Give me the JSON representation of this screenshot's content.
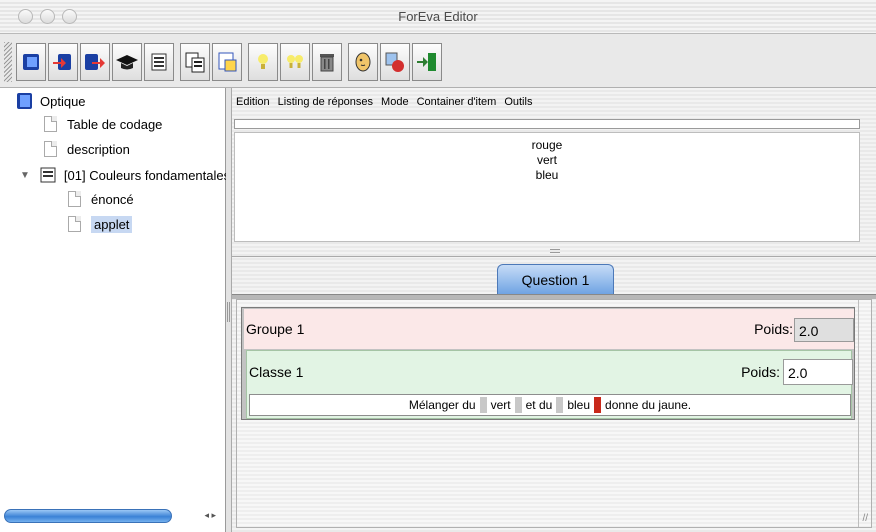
{
  "window": {
    "title": "ForEva Editor"
  },
  "toolbar": {
    "buttons": [
      {
        "icon": "open-book-icon",
        "color": "#1a3fa3"
      },
      {
        "icon": "book-import-icon",
        "color": "#d33"
      },
      {
        "icon": "book-export-icon",
        "color": "#d33"
      },
      {
        "icon": "graduation-cap-icon",
        "color": "#111"
      },
      {
        "icon": "list-icon",
        "color": "#333"
      },
      {
        "icon": "copy-documents-icon",
        "color": "#222"
      },
      {
        "icon": "paste-document-icon",
        "color": "#3355bb"
      },
      {
        "icon": "lightbulb-icon",
        "color": "#f2e34a"
      },
      {
        "icon": "double-lightbulb-icon",
        "color": "#f2e34a"
      },
      {
        "icon": "trash-icon",
        "color": "#666"
      },
      {
        "icon": "face-icon",
        "color": "#e6b84c"
      },
      {
        "icon": "stop-document-icon",
        "color": "#c62828"
      },
      {
        "icon": "exit-door-icon",
        "color": "#1f8a2f"
      }
    ]
  },
  "tree": {
    "root": "Optique",
    "items": [
      {
        "label": "Table de codage"
      },
      {
        "label": "description"
      },
      {
        "label": "[01] Couleurs fondamentales"
      },
      {
        "label": "énoncé"
      },
      {
        "label": "applet"
      }
    ]
  },
  "menu": [
    "Edition",
    "Listing de réponses",
    "Mode",
    "Container d'item",
    "Outils"
  ],
  "answers": [
    "rouge",
    "vert",
    "bleu"
  ],
  "tab": {
    "label": "Question 1"
  },
  "group": {
    "title": "Groupe 1",
    "weight_label": "Poids:",
    "weight_value": "2.0"
  },
  "class": {
    "title": "Classe 1",
    "weight_label": "Poids:",
    "weight_value": "2.0"
  },
  "sentence": {
    "parts": [
      "Mélanger du",
      "vert",
      "et du",
      "bleu",
      "donne du jaune."
    ]
  }
}
